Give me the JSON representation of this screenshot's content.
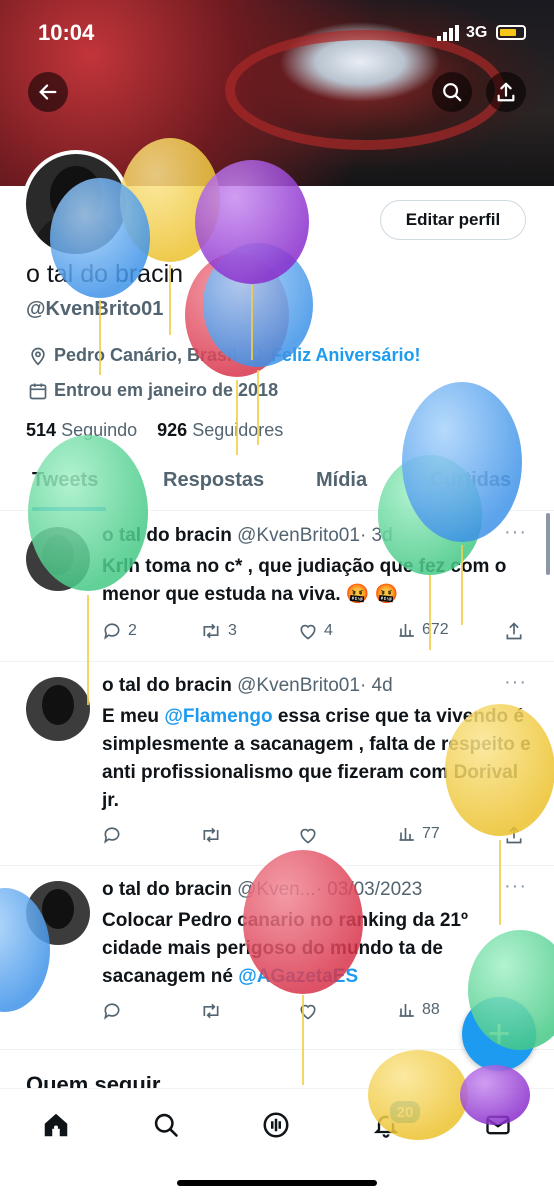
{
  "status_bar": {
    "time": "10:04",
    "network": "3G"
  },
  "header": {
    "back_icon": "arrow-left-icon",
    "search_icon": "search-icon",
    "share_icon": "share-icon"
  },
  "profile": {
    "name": "o tal do bracin",
    "handle": "@KvenBrito01",
    "edit_button": "Editar perfil",
    "location": "Pedro Canário, Brasil",
    "birthday_link": "Feliz Aniversário!",
    "joined": "Entrou em janeiro de 2018",
    "following_count": "514",
    "following_label": "Seguindo",
    "followers_count": "926",
    "followers_label": "Seguidores"
  },
  "tabs": [
    {
      "label": "Tweets",
      "active": true
    },
    {
      "label": "Respostas",
      "active": false
    },
    {
      "label": "Mídia",
      "active": false
    },
    {
      "label": "Curtidas",
      "active": false
    }
  ],
  "tweets": [
    {
      "name": "o tal do bracin",
      "handle": "@KvenBrito01",
      "time": "· 3d",
      "text": "Krlh toma no c* , que judiação que fez com o menor que estuda na viva. 🤬 🤬",
      "replies": "2",
      "retweets": "3",
      "likes": "4",
      "views": "672"
    },
    {
      "name": "o tal do bracin",
      "handle": "@KvenBrito01",
      "time": "· 4d",
      "mention": "@Flamengo",
      "text": "essa crise que ta vivendo é simplesmente a sacanagem , falta de respeito e anti profissionalismo que fizeram com  Dorival jr.",
      "text_prefix": "E meu",
      "replies": "",
      "retweets": "",
      "likes": "",
      "views": "77"
    },
    {
      "name": "o tal do bracin",
      "handle": "@Kven...",
      "time": "· 03/03/2023",
      "text": "Colocar Pedro canario no ranking da  21º cidade mais perigoso do mundo ta de sacanagem né",
      "mention": "@AGazetaES",
      "replies": "",
      "retweets": "",
      "likes": "",
      "views": "88"
    }
  ],
  "who_to_follow": "Quem seguir",
  "fab_label": "+",
  "bottom_nav": {
    "items": [
      "home-icon",
      "search-icon",
      "spaces-icon",
      "notifications-icon",
      "messages-icon"
    ],
    "notification_badge": "20"
  },
  "balloon_colors": {
    "blue": "#5aa9f0",
    "yellow": "#f2cf4a",
    "purple": "#9b3fd6",
    "red": "#e0475a",
    "green": "#5fd69a"
  }
}
